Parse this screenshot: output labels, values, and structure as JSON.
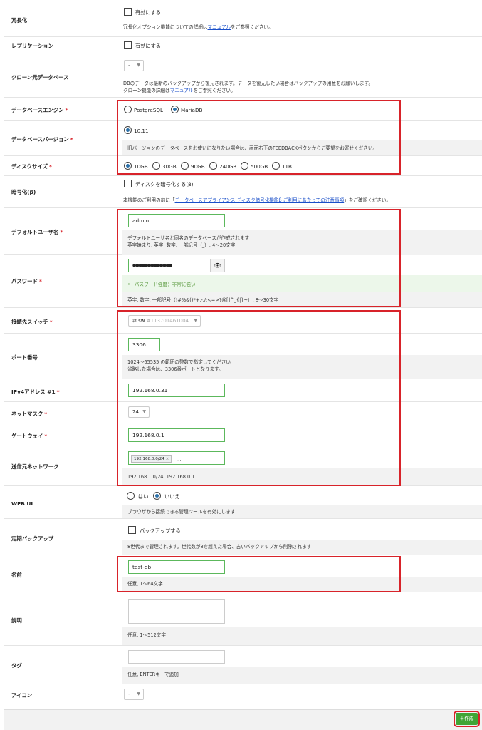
{
  "redundancy": {
    "label": "冗長化",
    "check": "有効にする",
    "note_pre": "冗長化オプション機能についての詳細は",
    "note_link": "マニュアル",
    "note_post": "をご参照ください。"
  },
  "replication": {
    "label": "レプリケーション",
    "check": "有効にする"
  },
  "clone": {
    "label": "クローン元データベース",
    "select": "-",
    "note1": "DBのデータは最新のバックアップから復元されます。データを復元したい場合はバックアップの用意をお願いします。",
    "note2_pre": "クローン機能の詳細は",
    "note2_link": "マニュアル",
    "note2_post": "をご参照ください。"
  },
  "engine": {
    "label": "データベースエンジン",
    "options": [
      "PostgreSQL",
      "MariaDB"
    ],
    "selected": "MariaDB"
  },
  "version": {
    "label": "データベースバージョン",
    "value": "10.11",
    "note": "旧バージョンのデータベースをお使いになりたい場合は、画面右下のFEEDBACKボタンからご要望をお寄せください。"
  },
  "disk": {
    "label": "ディスクサイズ",
    "options": [
      "10GB",
      "30GB",
      "90GB",
      "240GB",
      "500GB",
      "1TB"
    ],
    "selected": "10GB"
  },
  "encrypt": {
    "label": "暗号化(β)",
    "check": "ディスクを暗号化する(β)",
    "note_pre": "本機能のご利用の前に「",
    "note_link": "データベースアプライアンス ディスク暗号化機能β ご利用にあたっての注意事項",
    "note_post": "」をご確認ください。"
  },
  "user": {
    "label": "デフォルトユーザ名",
    "value": "admin",
    "note1": "デフォルトユーザ名と同名のデータベースが作成されます",
    "note2": "英字始まり, 英字, 数字, 一部記号（_）, 4～20文字"
  },
  "password": {
    "label": "パスワード",
    "value": "●●●●●●●●●●●●●",
    "strength": "パスワード強度：非常に強い",
    "note": "英字, 数字, 一部記号（!#%&()*+,-./;<=>?@[]^_{|}~）, 8～30文字"
  },
  "switch": {
    "label": "接続先スイッチ",
    "value": "sw",
    "id": "#113701461004"
  },
  "port": {
    "label": "ポート番号",
    "value": "3306",
    "note1": "1024～65535 の範囲の整数で指定してください",
    "note2": "省略した場合は、3306番ポートとなります。"
  },
  "ipv4": {
    "label": "IPv4アドレス #1",
    "value": "192.168.0.31"
  },
  "netmask": {
    "label": "ネットマスク",
    "value": "24"
  },
  "gateway": {
    "label": "ゲートウェイ",
    "value": "192.168.0.1"
  },
  "source": {
    "label": "送信元ネットワーク",
    "tag": "192.168.0.0/24",
    "more": "...",
    "note": "192.168.1.0/24, 192.168.0.1"
  },
  "webui": {
    "label": "WEB UI",
    "options": [
      "はい",
      "いいえ"
    ],
    "selected": "いいえ",
    "note": "ブラウザから接続できる管理ツールを有効にします"
  },
  "backup": {
    "label": "定期バックアップ",
    "check": "バックアップする",
    "note": "8世代まで管理されます。世代数が8を超えた場合、古いバックアップから削除されます"
  },
  "name": {
    "label": "名前",
    "value": "test-db",
    "note": "任意, 1～64文字"
  },
  "description": {
    "label": "説明",
    "note": "任意, 1～512文字"
  },
  "tags": {
    "label": "タグ",
    "note": "任意, ENTERキーで追加"
  },
  "icon": {
    "label": "アイコン",
    "select": "-"
  },
  "footer": {
    "create": "作成"
  },
  "required_mark": "*",
  "colors": {
    "required": "#d8232a",
    "highlight": "#d8232a",
    "create_button": "#3fa535",
    "link": "#1a4fc9"
  }
}
